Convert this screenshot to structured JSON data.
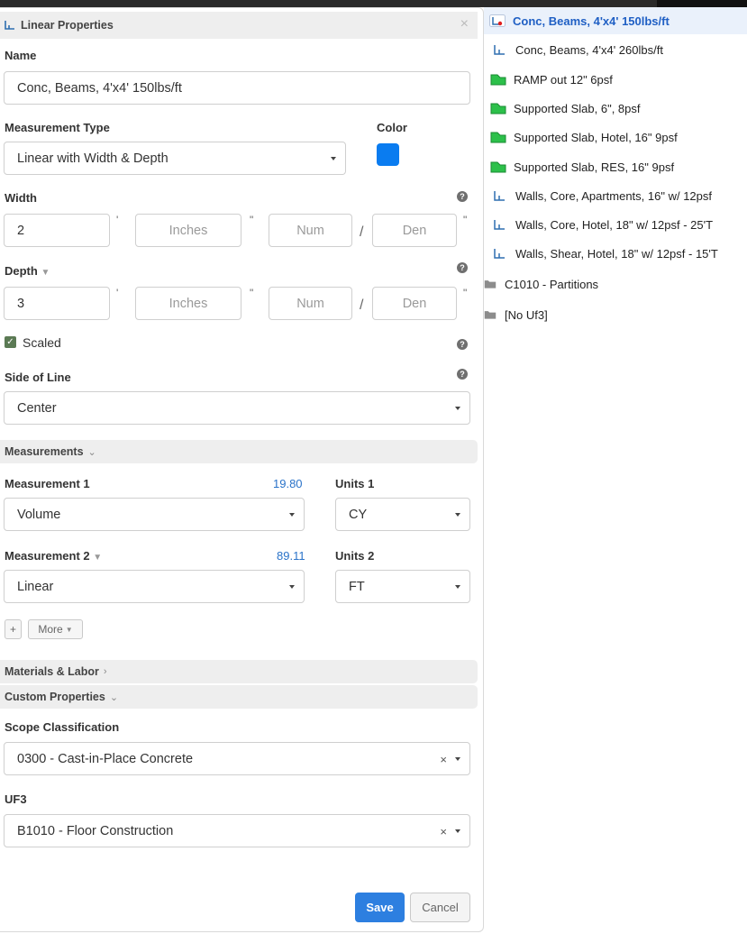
{
  "panel": {
    "title": "Linear Properties",
    "close": "×",
    "name_label": "Name",
    "name_value": "Conc, Beams, 4'x4' 150lbs/ft",
    "measurement_type_label": "Measurement Type",
    "measurement_type_value": "Linear with Width & Depth",
    "color_label": "Color",
    "color_value": "#0a7cf0",
    "width_label": "Width",
    "width": {
      "feet": "2",
      "inches_placeholder": "Inches",
      "num_placeholder": "Num",
      "den_placeholder": "Den",
      "feet_mark": "'",
      "inch_mark": "\"",
      "slash": "/"
    },
    "depth_label": "Depth",
    "depth": {
      "feet": "3",
      "inches_placeholder": "Inches",
      "num_placeholder": "Num",
      "den_placeholder": "Den"
    },
    "scaled_label": "Scaled",
    "scaled_checked": true,
    "side_of_line_label": "Side of Line",
    "side_of_line_value": "Center",
    "measurements_section": "Measurements",
    "measurement1_label": "Measurement 1",
    "measurement1_result": "19.80",
    "units1_label": "Units 1",
    "measurement1_value": "Volume",
    "units1_value": "CY",
    "measurement2_label": "Measurement 2",
    "measurement2_result": "89.11",
    "units2_label": "Units 2",
    "measurement2_value": "Linear",
    "units2_value": "FT",
    "add_button": "+",
    "more_button": "More",
    "materials_section": "Materials & Labor",
    "custom_section": "Custom Properties",
    "scope_label": "Scope Classification",
    "scope_value": "0300 - Cast-in-Place Concrete",
    "uf3_label": "UF3",
    "uf3_value": "B1010 - Floor Construction",
    "clear_mark": "×",
    "save": "Save",
    "cancel": "Cancel",
    "help": "?"
  },
  "list": {
    "items": [
      {
        "label": "Conc, Beams, 4'x4' 150lbs/ft",
        "icon": "linear-icon-selected",
        "selected": true
      },
      {
        "label": "Conc, Beams, 4'x4' 260lbs/ft",
        "icon": "linear-icon"
      },
      {
        "label": "RAMP out 12\" 6psf",
        "icon": "area-icon"
      },
      {
        "label": "Supported Slab, 6\", 8psf",
        "icon": "area-icon"
      },
      {
        "label": "Supported Slab, Hotel, 16\" 9psf",
        "icon": "area-icon"
      },
      {
        "label": "Supported Slab, RES, 16\" 9psf",
        "icon": "area-icon"
      },
      {
        "label": "Walls, Core, Apartments, 16\" w/ 12psf",
        "icon": "linear-icon"
      },
      {
        "label": "Walls, Core, Hotel, 18\" w/ 12psf - 25'T",
        "icon": "linear-icon"
      },
      {
        "label": "Walls, Shear, Hotel, 18\" w/ 12psf - 15'T",
        "icon": "linear-icon"
      },
      {
        "label": "C1010 - Partitions",
        "icon": "folder-icon"
      },
      {
        "label": "[No Uf3]",
        "icon": "folder-icon"
      }
    ]
  },
  "colors": {
    "accent": "#2d7fe0",
    "value_blue": "#2a73c9",
    "area_green": "#2cc04a",
    "linear_blue": "#2f6fb0"
  }
}
